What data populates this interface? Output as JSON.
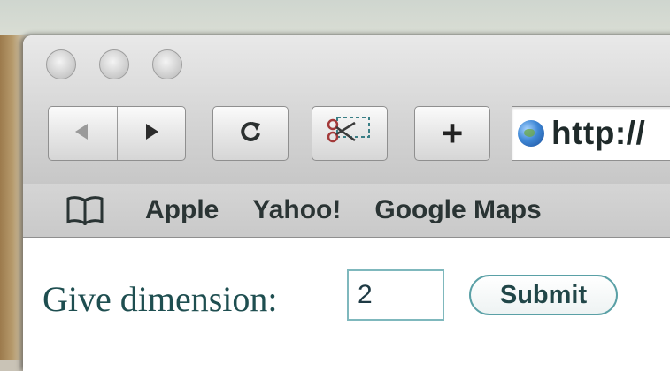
{
  "toolbar": {
    "window_controls": [
      "close",
      "minimize",
      "zoom"
    ],
    "back_icon": "back-arrow-icon",
    "forward_icon": "forward-arrow-icon",
    "reload_icon": "reload-icon",
    "snip_icon": "snip-scissors-icon",
    "add_bookmark_symbol": "+"
  },
  "address": {
    "text": "http://",
    "icon": "globe-icon"
  },
  "bookmarks": {
    "icon": "book-icon",
    "items": [
      "Apple",
      "Yahoo!",
      "Google Maps"
    ]
  },
  "form": {
    "label": "Give dimension:",
    "input_value": "2",
    "submit_label": "Submit"
  },
  "colors": {
    "form_text": "#1e4e50",
    "input_border": "#7fb8bd",
    "button_border": "#5aa0a6"
  }
}
